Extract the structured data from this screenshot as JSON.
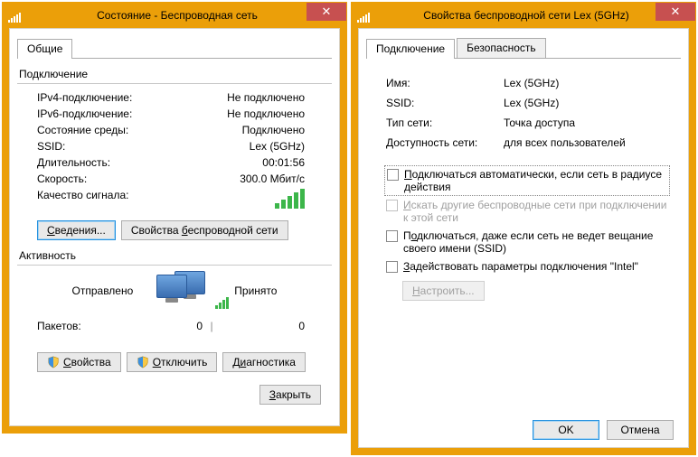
{
  "win1": {
    "title": "Состояние - Беспроводная сеть",
    "tab_general": "Общие",
    "sec_conn": "Подключение",
    "rows": {
      "ipv4_k": "IPv4-подключение:",
      "ipv4_v": "Не подключено",
      "ipv6_k": "IPv6-подключение:",
      "ipv6_v": "Не подключено",
      "media_k": "Состояние среды:",
      "media_v": "Подключено",
      "ssid_k": "SSID:",
      "ssid_v": "Lex (5GHz)",
      "dur_k": "Длительность:",
      "dur_v": "00:01:56",
      "speed_k": "Скорость:",
      "speed_v": "300.0 Мбит/с",
      "sig_k": "Качество сигнала:"
    },
    "btn_details": "Сведения...",
    "btn_wprops": "Свойства беспроводной сети",
    "sec_activity": "Активность",
    "sent": "Отправлено",
    "recv": "Принято",
    "packets_label": "Пакетов:",
    "packets_sent": "0",
    "packets_recv": "0",
    "btn_props": "Свойства",
    "btn_disable": "Отключить",
    "btn_diag": "Диагностика",
    "btn_close": "Закрыть"
  },
  "win2": {
    "title": "Свойства беспроводной сети Lex (5GHz)",
    "tab_conn": "Подключение",
    "tab_sec": "Безопасность",
    "rows": {
      "name_k": "Имя:",
      "name_v": "Lex (5GHz)",
      "ssid_k": "SSID:",
      "ssid_v": "Lex (5GHz)",
      "type_k": "Тип сети:",
      "type_v": "Точка доступа",
      "avail_k": "Доступность сети:",
      "avail_v": "для всех пользователей"
    },
    "chk1": "Подключаться автоматически, если сеть в радиусе действия",
    "chk2": "Искать другие беспроводные сети при подключении к этой сети",
    "chk3": "Подключаться, даже если сеть не ведет вещание своего имени (SSID)",
    "chk4": "Задействовать параметры подключения \"Intel\"",
    "btn_config": "Настроить...",
    "btn_ok": "OK",
    "btn_cancel": "Отмена"
  }
}
